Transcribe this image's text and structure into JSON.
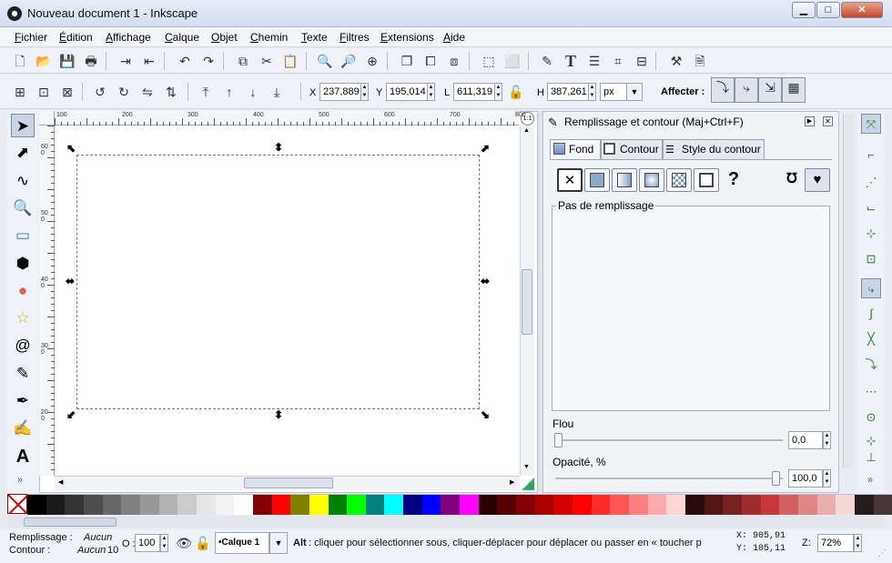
{
  "window": {
    "title": "Nouveau document 1 - Inkscape",
    "controls": [
      "▁",
      "□",
      "✕"
    ]
  },
  "menu": [
    {
      "u": "F",
      "rest": "ichier"
    },
    {
      "u": "É",
      "rest": "dition"
    },
    {
      "u": "A",
      "rest": "ffichage"
    },
    {
      "u": "C",
      "rest": "alque"
    },
    {
      "u": "O",
      "rest": "bjet"
    },
    {
      "u": "C",
      "rest": "hemin"
    },
    {
      "u": "T",
      "rest": "exte"
    },
    {
      "u": "F",
      "rest": "iltres"
    },
    {
      "u": "E",
      "rest": "xtensions"
    },
    {
      "u": "A",
      "rest": "ide"
    }
  ],
  "toolbar": {
    "icons": [
      "new-icon",
      "open-icon",
      "save-icon",
      "print-icon",
      "import-icon",
      "export-icon",
      "undo-icon",
      "redo-icon",
      "copy-icon",
      "cut-icon",
      "paste-icon",
      "zoom-selection-icon",
      "zoom-drawing-icon",
      "zoom-page-icon",
      "duplicate-icon",
      "clone-icon",
      "unlink-clone-icon",
      "group-icon",
      "ungroup-icon",
      "fill-stroke-icon",
      "text-icon",
      "layers-icon",
      "xml-editor-icon",
      "align-icon",
      "preferences-icon",
      "document-properties-icon"
    ]
  },
  "controls": {
    "x_label": "X",
    "x_value": "237,889",
    "y_label": "Y",
    "y_value": "195,014",
    "w_label": "L",
    "w_value": "611,319",
    "h_label": "H",
    "h_value": "387,261",
    "unit": "px",
    "affect_label": "Affecter :"
  },
  "ruler": {
    "h_labels": [
      "100",
      "200",
      "300",
      "400",
      "500",
      "600",
      "700",
      "800"
    ],
    "v_labels": [
      "600",
      "500",
      "400",
      "300",
      "200"
    ]
  },
  "panel": {
    "title": "Remplissage et contour (Maj+Ctrl+F)",
    "tabs": [
      "Fond",
      "Contour",
      "Style du contour"
    ],
    "fill_none_label": "Pas de remplissage",
    "blur_label": "Flou",
    "blur_value": "0,0",
    "opacity_label": "Opacité, %",
    "opacity_value": "100,0",
    "unknown_btn": "?"
  },
  "palette": {
    "colors": [
      "#000000",
      "#1a1a1a",
      "#333333",
      "#4d4d4d",
      "#666666",
      "#808080",
      "#999999",
      "#b3b3b3",
      "#cccccc",
      "#e6e6e6",
      "#f2f2f2",
      "#ffffff",
      "#800000",
      "#ff0000",
      "#808000",
      "#ffff00",
      "#008000",
      "#00ff00",
      "#008080",
      "#00ffff",
      "#000080",
      "#0000ff",
      "#800080",
      "#ff00ff",
      "#2b0000",
      "#550000",
      "#800000",
      "#aa0000",
      "#d40000",
      "#ff0000",
      "#ff2a2a",
      "#ff5555",
      "#ff8080",
      "#ffaaaa",
      "#ffd5d5",
      "#280b0b",
      "#501616",
      "#782121",
      "#a02c2c",
      "#c83737",
      "#d35f5f",
      "#de8787",
      "#e9afaf",
      "#f4d7d7",
      "#241c1c",
      "#483737"
    ]
  },
  "status": {
    "fill_label": "Remplissage :",
    "fill_value": "Aucun",
    "stroke_label": "Contour :",
    "stroke_value": "Aucun",
    "stroke_width": "10",
    "opacity_label": "O :",
    "opacity_value": "100",
    "layer": "•Calque 1",
    "hint_bold": "Alt",
    "hint": " : cliquer pour sélectionner sous, cliquer-déplacer pour déplacer ou passer en « toucher p",
    "x": "X: 905,91",
    "y": "Y: 105,11",
    "zoom_label": "Z:",
    "zoom_value": "72%"
  }
}
